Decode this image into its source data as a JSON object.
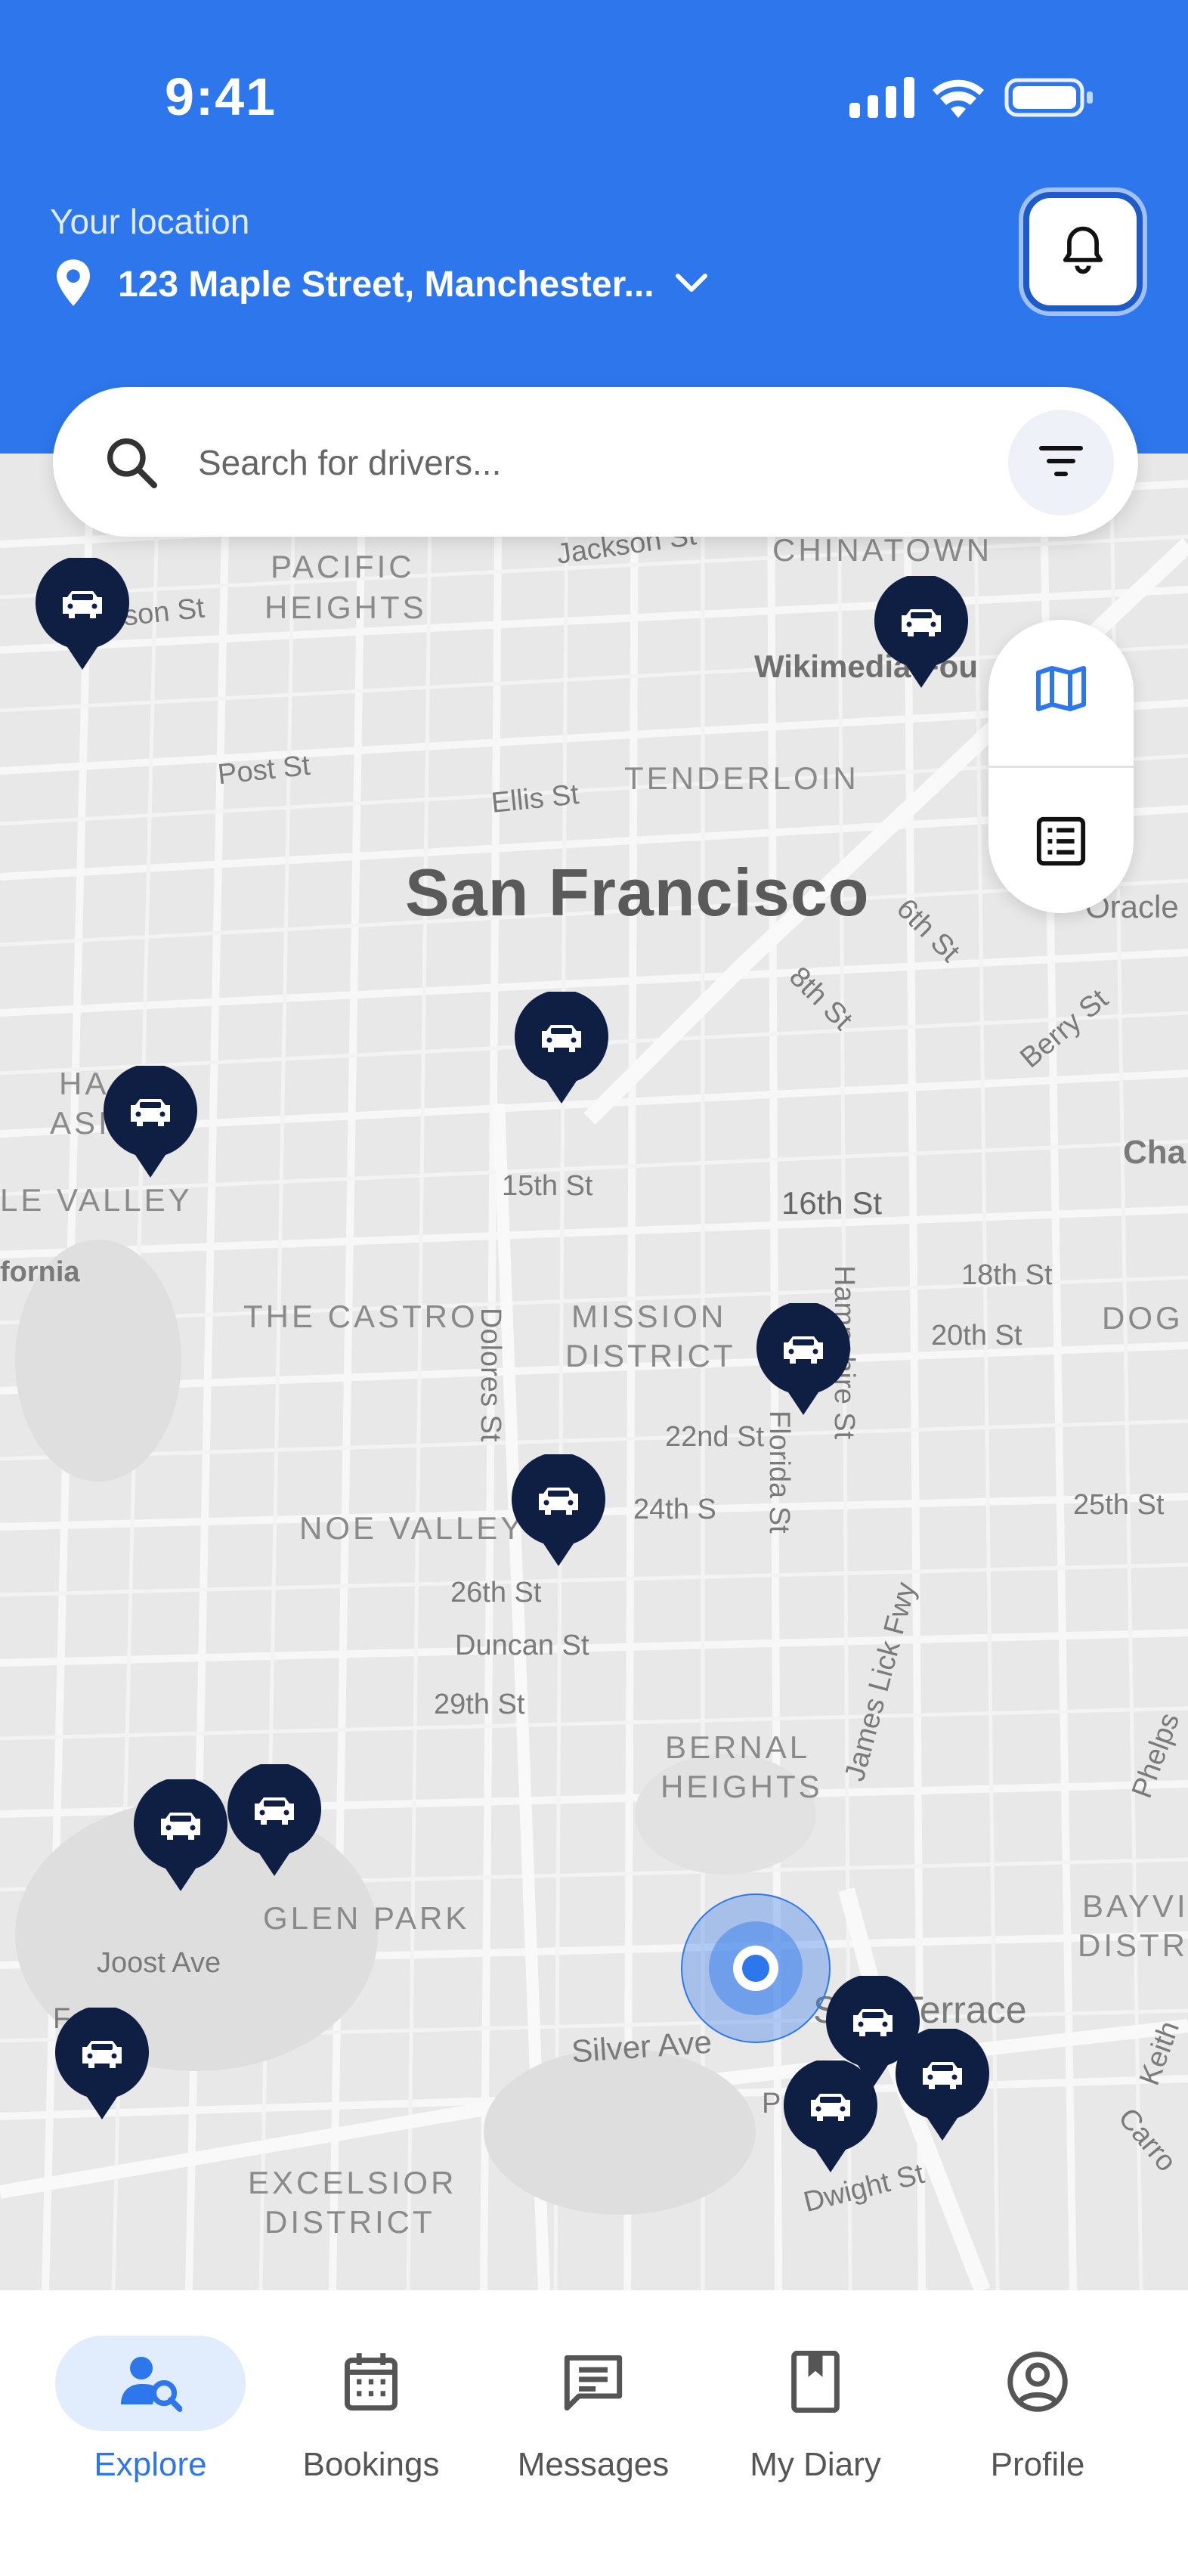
{
  "status_bar": {
    "time": "9:41"
  },
  "header": {
    "location_label": "Your location",
    "location_value": "123 Maple Street, Manchester...",
    "accent_color": "#2d76ec"
  },
  "search": {
    "placeholder": "Search for drivers..."
  },
  "map": {
    "city": "San Francisco",
    "districts": [
      "PACIFIC",
      "HEIGHTS",
      "CHINATOWN",
      "TENDERLOIN",
      "THE CASTRO",
      "MISSION",
      "DISTRICT",
      "NOE VALLEY",
      "BERNAL",
      "HEIGHTS",
      "GLEN PARK",
      "EXCELSIOR",
      "DISTRICT",
      "HA",
      "ASI",
      "LE VALLEY",
      "DOG",
      "BAYVI",
      "DISTR"
    ],
    "streets": [
      "Jackson St",
      "kson St",
      "Post St",
      "Ellis St",
      "Wikimedia Fou",
      "6th St",
      "8th St",
      "Berry St",
      "Oracle",
      "Cha",
      "15th St",
      "16th St",
      "18th St",
      "20th St",
      "fornia",
      "Dolores St",
      "Hampshire St",
      "22nd St",
      "24th S",
      "Florida St",
      "25th St",
      "26th St",
      "Duncan St",
      "29th St",
      "James Lick Fwy",
      "Phelps",
      "Joost Ave",
      "F     Ave",
      "Silver Ave",
      "S      Terrace",
      "Keith",
      "Carro",
      "Dwight St",
      "P"
    ],
    "driver_pin_icon": "car-icon",
    "driver_pin_color": "#0f1f44",
    "user_location_color": "#2d76ec"
  },
  "view_toggle": {
    "map_icon": "map-icon",
    "list_icon": "list-icon"
  },
  "tabbar": {
    "tabs": [
      {
        "label": "Explore",
        "icon": "user-search-icon",
        "active": true
      },
      {
        "label": "Bookings",
        "icon": "calendar-icon",
        "active": false
      },
      {
        "label": "Messages",
        "icon": "message-icon",
        "active": false
      },
      {
        "label": "My Diary",
        "icon": "bookmark-icon",
        "active": false
      },
      {
        "label": "Profile",
        "icon": "profile-icon",
        "active": false
      }
    ]
  }
}
